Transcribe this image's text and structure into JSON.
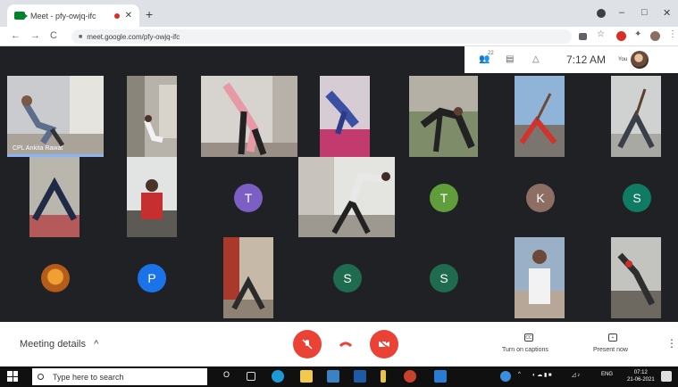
{
  "browser": {
    "tab_title": "Meet - pfy-owjq-ifc",
    "new_tab": "+",
    "minimize": "–",
    "restore": "□",
    "close": "✕",
    "back": "←",
    "forward": "→",
    "reload": "C",
    "url": "meet.google.com/pfy-owjq-ifc"
  },
  "meet_topbar": {
    "participants_count": "22",
    "time": "7:12 AM",
    "self_label": "You"
  },
  "tiles": {
    "presenter_name": "CPL Ankita Rawat"
  },
  "avatars": [
    {
      "letter": "T",
      "color": "#7b5fc4"
    },
    {
      "letter": "T",
      "color": "#5f9e3a"
    },
    {
      "letter": "K",
      "color": "#8d6e63"
    },
    {
      "letter": "S",
      "color": "#0f7b63"
    },
    {
      "letter": "P",
      "color": "#1a73e8"
    },
    {
      "letter": "S",
      "color": "#1e6b4f"
    },
    {
      "letter": "S",
      "color": "#1e6b4f"
    }
  ],
  "bottom": {
    "meeting_details": "Meeting details",
    "meeting_chevron": "^",
    "captions_label": "Turn on captions",
    "captions_icon": "CC",
    "present_label": "Present now",
    "present_icon": "+",
    "more": "⋮"
  },
  "taskbar": {
    "search_placeholder": "Type here to search",
    "cortana": "O",
    "lang": "ENG",
    "time": "07:12",
    "date": "21-06-2021"
  },
  "colors": {
    "mic_off": "#ea4335",
    "end_call": "#ffffff",
    "cam_off": "#ea4335"
  }
}
